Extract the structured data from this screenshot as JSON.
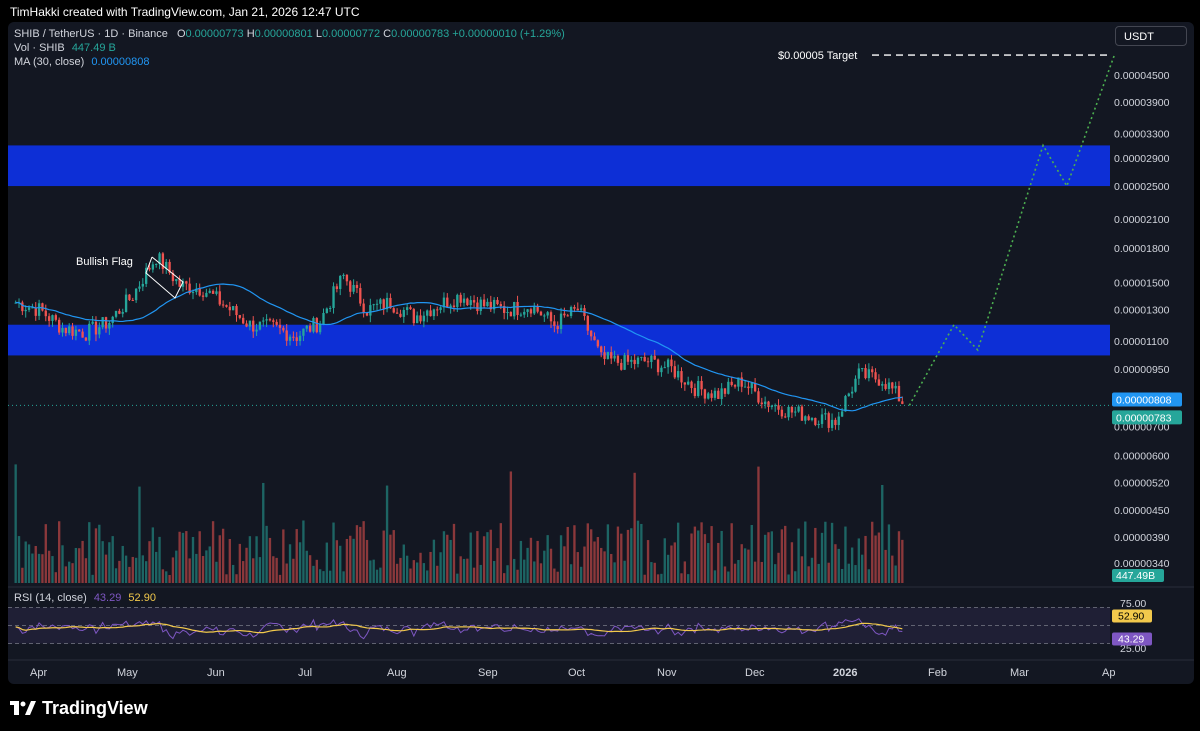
{
  "header": {
    "attribution": "TimHakki created with TradingView.com, Jan 21, 2026 12:47 UTC"
  },
  "legend": {
    "symbol": "SHIB / TetherUS · 1D · Binance",
    "o_label": "O",
    "o": "0.00000773",
    "h_label": "H",
    "h": "0.00000801",
    "l_label": "L",
    "l": "0.00000772",
    "c_label": "C",
    "c": "0.00000783",
    "change": "+0.00000010 (+1.29%)",
    "vol_label": "Vol · SHIB",
    "vol": "447.49 B",
    "ma_label": "MA (30, close)",
    "ma": "0.00000808",
    "rsi_label": "RSI (14, close)",
    "rsi": "43.29",
    "rsi_ma": "52.90"
  },
  "currency_button": "USDT",
  "branding": "TradingView",
  "annotations": {
    "flag": "Bullish Flag",
    "target": "$0.00005 Target"
  },
  "colors": {
    "up": "#26a69a",
    "down": "#ef5350",
    "ma": "#2196f3",
    "zone": "#0d2fd6",
    "rsi": "#7e57c2",
    "rsi_ma": "#f2c94c",
    "projection": "#4caf50"
  },
  "chart_data": [
    {
      "type": "candlestick",
      "y_ticks": [
        "0.00004500",
        "0.00003900",
        "0.00003300",
        "0.00002900",
        "0.00002500",
        "0.00002100",
        "0.00001800",
        "0.00001500",
        "0.00001300",
        "0.00001100",
        "0.00000950",
        "0.00000700",
        "0.00000600",
        "0.00000520",
        "0.00000450",
        "0.00000390",
        "0.00000340"
      ],
      "y_scale": "log",
      "x_ticks": [
        "Apr",
        "May",
        "Jun",
        "Jul",
        "Aug",
        "Sep",
        "Oct",
        "Nov",
        "Dec",
        "2026",
        "Feb",
        "Mar",
        "Ap"
      ],
      "price_labels": {
        "ma": "0.00000808",
        "last": "0.00000783",
        "volume": "447.49B"
      },
      "zones": [
        {
          "from": 2.5e-05,
          "to": 3.1e-05
        },
        {
          "from": 1.02e-05,
          "to": 1.2e-05
        }
      ],
      "projection_path": [
        {
          "date": "2026-01-22",
          "value": 7.83e-06
        },
        {
          "date": "2026-02-06",
          "value": 1.2e-05
        },
        {
          "date": "2026-02-14",
          "value": 1.05e-05
        },
        {
          "date": "2026-03-08",
          "value": 3.1e-05
        },
        {
          "date": "2026-03-16",
          "value": 2.5e-05
        },
        {
          "date": "2026-04-01",
          "value": 5e-05
        }
      ],
      "target_value": 5e-05,
      "ohlc_weekly_close": [
        1.35e-05,
        1.3e-05,
        1.18e-05,
        1.15e-05,
        1.22e-05,
        1.4e-05,
        1.72e-05,
        1.48e-05,
        1.45e-05,
        1.32e-05,
        1.2e-05,
        1.18e-05,
        1.13e-05,
        1.22e-05,
        1.55e-05,
        1.3e-05,
        1.35e-05,
        1.25e-05,
        1.33e-05,
        1.4e-05,
        1.33e-05,
        1.3e-05,
        1.33e-05,
        1.2e-05,
        1.3e-05,
        1e-05,
        9.8e-06,
        9.9e-06,
        9.5e-06,
        8.6e-06,
        8.3e-06,
        8.9e-06,
        8e-06,
        7.6e-06,
        7.4e-06,
        7.2e-06,
        9.2e-06,
        9e-06,
        7.83e-06
      ]
    },
    {
      "type": "line",
      "name": "RSI (14, close)",
      "y_ticks": [
        "75.00",
        "25.00"
      ],
      "last": {
        "rsi": "43.29",
        "ma": "52.90"
      }
    }
  ]
}
